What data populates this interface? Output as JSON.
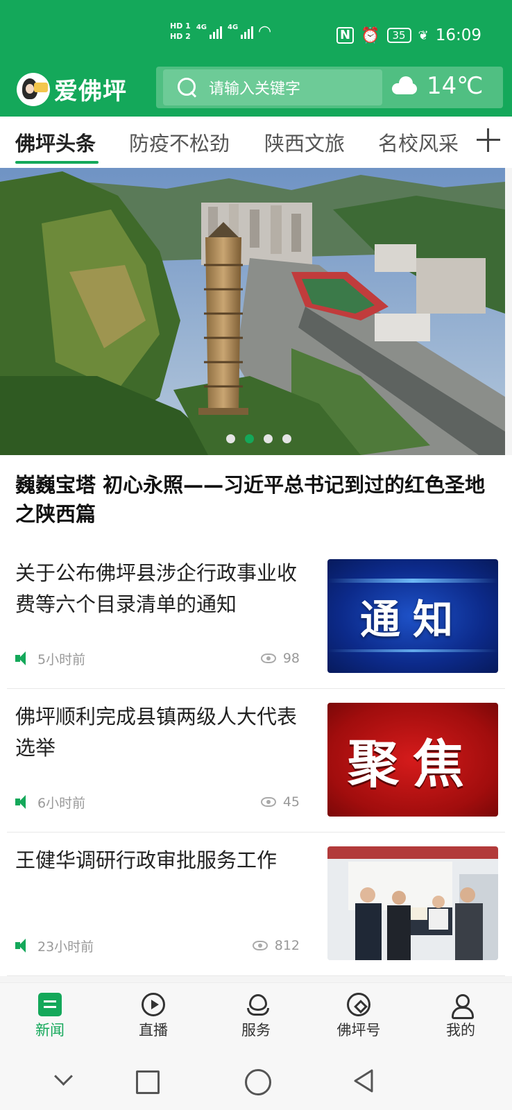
{
  "status_bar": {
    "hd1": "HD 1",
    "hd2": "HD 2",
    "network1": "4G",
    "network2": "4G",
    "battery": "35",
    "time": "16:09"
  },
  "header": {
    "app_name": "爱佛坪",
    "search": {
      "placeholder": "请输入关键字"
    },
    "weather": {
      "icon": "cloud-icon",
      "temperature": "14℃"
    }
  },
  "tabs": [
    {
      "label": "佛坪头条",
      "active": true
    },
    {
      "label": "防疫不松劲",
      "active": false
    },
    {
      "label": "陕西文旅",
      "active": false
    },
    {
      "label": "名校风采",
      "active": false
    }
  ],
  "banner": {
    "title": "巍巍宝塔 初心永照——习近平总书记到过的红色圣地之陕西篇",
    "slide_count": 4,
    "active_slide": 2
  },
  "news": [
    {
      "title": "关于公布佛坪县涉企行政事业收费等六个目录清单的通知",
      "time": "5小时前",
      "views": "98",
      "thumb_text": "通知"
    },
    {
      "title": "佛坪顺利完成县镇两级人大代表选举",
      "time": "6小时前",
      "views": "45",
      "thumb_text": "聚焦"
    },
    {
      "title": "王健华调研行政审批服务工作",
      "time": "23小时前",
      "views": "812",
      "thumb_text": ""
    }
  ],
  "bottom_nav": [
    {
      "label": "新闻",
      "icon": "news-icon",
      "active": true
    },
    {
      "label": "直播",
      "icon": "live-icon",
      "active": false
    },
    {
      "label": "服务",
      "icon": "service-icon",
      "active": false
    },
    {
      "label": "佛坪号",
      "icon": "compass-icon",
      "active": false
    },
    {
      "label": "我的",
      "icon": "user-icon",
      "active": false
    }
  ],
  "colors": {
    "brand": "#14a85a",
    "text": "#222222",
    "muted": "#999999"
  }
}
